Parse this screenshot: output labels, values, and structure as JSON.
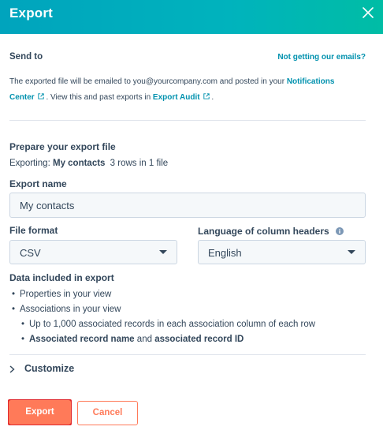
{
  "dialog": {
    "title": "Export",
    "close_icon": "close-icon"
  },
  "send_to": {
    "heading": "Send to",
    "help_link": "Not getting our emails?",
    "desc_before": "The exported file will be emailed to you@yourcompany.com and posted in your",
    "notifications_link_line1": "Notifications",
    "notifications_link_line2": "Center",
    "desc_middle": ". View this and past exports in",
    "audit_link": "Export Audit",
    "desc_end": "."
  },
  "prepare": {
    "heading": "Prepare your export file",
    "exporting_prefix": "Exporting:",
    "exporting_view": "My contacts",
    "exporting_summary": "3 rows in 1 file"
  },
  "export_name": {
    "label": "Export name",
    "value": "My contacts"
  },
  "file_format": {
    "label": "File format",
    "selected": "CSV"
  },
  "language": {
    "label": "Language of column headers",
    "selected": "English",
    "info_icon": "info-icon"
  },
  "data_included": {
    "heading": "Data included in export",
    "item1": "Properties in your view",
    "item2": "Associations in your view",
    "sub1": "Up to 1,000 associated records in each association column of each row",
    "sub2_bold1": "Associated record name",
    "sub2_mid": "and",
    "sub2_bold2": "associated record ID"
  },
  "customize": {
    "label": "Customize"
  },
  "footer": {
    "export_label": "Export",
    "cancel_label": "Cancel"
  },
  "colors": {
    "header_start": "#00a4bd",
    "header_end": "#00bda5",
    "accent": "#ff7a59",
    "link": "#0091ae",
    "text": "#33475b",
    "highlight_outline": "#e0262b"
  }
}
